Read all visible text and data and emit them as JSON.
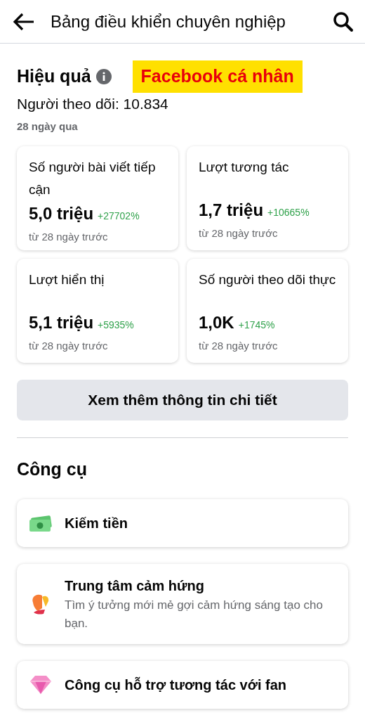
{
  "header": {
    "title": "Bảng điều khiển chuyên nghiệp"
  },
  "performance": {
    "title": "Hiệu quả",
    "annotation_label": "Facebook cá nhân",
    "followers": "Người theo dõi: 10.834",
    "period": "28 ngày qua"
  },
  "stats": [
    {
      "label": "Số người bài viết tiếp cận",
      "value": "5,0 triệu",
      "change": "+27702%",
      "note": "từ 28 ngày trước"
    },
    {
      "label": "Lượt tương tác",
      "value": "1,7 triệu",
      "change": "+10665%",
      "note": "từ 28 ngày trước"
    },
    {
      "label": "Lượt hiển thị",
      "value": "5,1 triệu",
      "change": "+5935%",
      "note": "từ 28 ngày trước"
    },
    {
      "label": "Số người theo dõi thực",
      "value": "1,0K",
      "change": "+1745%",
      "note": "từ 28 ngày trước"
    }
  ],
  "details_button": "Xem thêm thông tin chi tiết",
  "tools": {
    "title": "Công cụ",
    "items": [
      {
        "kind": "money",
        "title": "Kiếm tiền"
      },
      {
        "kind": "butterfly",
        "title": "Trung tâm cảm hứng",
        "description": "Tìm ý tưởng mới mẻ gợi cảm hứng sáng tạo cho bạn."
      },
      {
        "kind": "diamond",
        "title": "Công cụ hỗ trợ tương tác với fan"
      }
    ]
  }
}
